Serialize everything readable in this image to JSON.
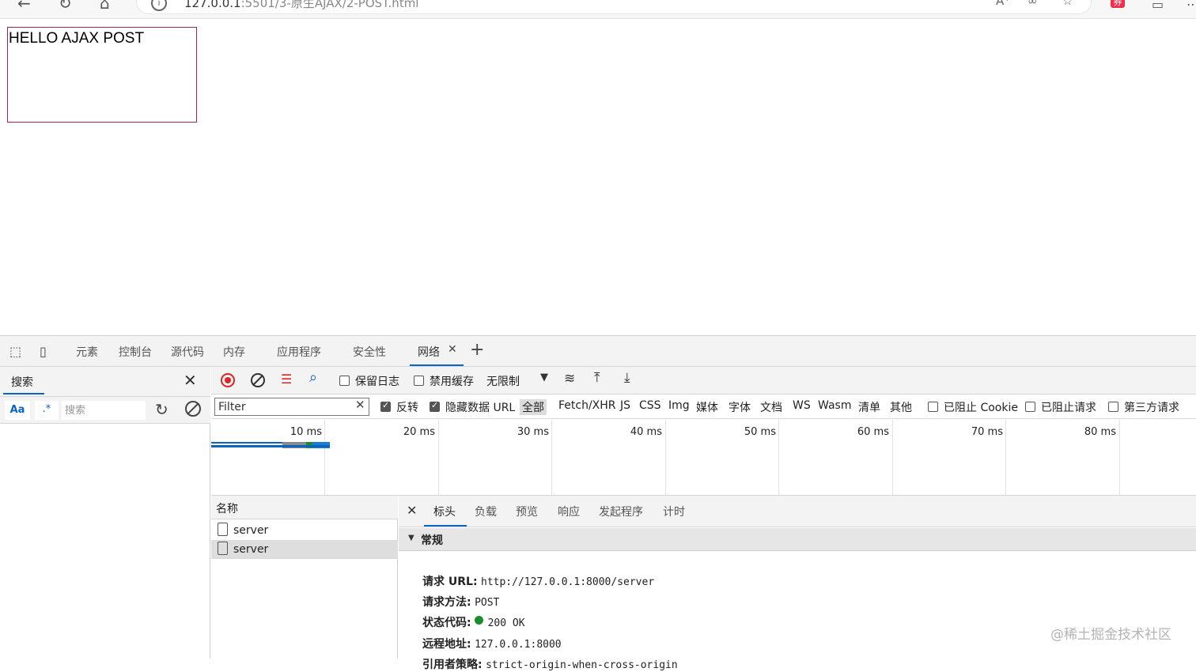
{
  "browser": {
    "url_host": "127.0.0.1",
    "url_rest": ":5501/3-原生AJAX/2-POST.html",
    "back_icon": "arrow-left-icon",
    "reload_icon": "reload-icon",
    "home_icon": "home-icon",
    "shop_badge": "券"
  },
  "page": {
    "box_text": "HELLO AJAX POST",
    "box_border_color": "#a0225a"
  },
  "devtools": {
    "tabs": [
      "元素",
      "控制台",
      "源代码",
      "内存",
      "应用程序",
      "安全性",
      "网络"
    ],
    "active_tab": "网络",
    "search_panel": {
      "tab_label": "搜索",
      "case_label": "Aa",
      "regex_label": ".*",
      "placeholder": "搜索"
    },
    "toolbar": {
      "preserve_log": "保留日志",
      "disable_cache": "禁用缓存",
      "throttle": "无限制"
    },
    "filter": {
      "placeholder": "Filter",
      "invert": "反转",
      "hide_data_urls": "隐藏数据 URL",
      "types": [
        "全部",
        "Fetch/XHR",
        "JS",
        "CSS",
        "Img",
        "媒体",
        "字体",
        "文档",
        "WS",
        "Wasm",
        "清单",
        "其他"
      ],
      "blocked_cookies": "已阻止 Cookie",
      "blocked_requests": "已阻止请求",
      "third_party": "第三方请求"
    },
    "timeline": {
      "ticks": [
        "10 ms",
        "20 ms",
        "30 ms",
        "40 ms",
        "50 ms",
        "60 ms",
        "70 ms",
        "80 ms"
      ]
    },
    "requests": {
      "header": "名称",
      "rows": [
        {
          "name": "server",
          "selected": false
        },
        {
          "name": "server",
          "selected": true
        }
      ]
    },
    "details": {
      "tabs": [
        "标头",
        "负载",
        "预览",
        "响应",
        "发起程序",
        "计时"
      ],
      "active_tab": "标头",
      "section_title": "常规",
      "fields": [
        {
          "key": "请求 URL:",
          "value": "http://127.0.0.1:8000/server"
        },
        {
          "key": "请求方法:",
          "value": "POST"
        },
        {
          "key": "状态代码:",
          "value": "200 OK"
        },
        {
          "key": "远程地址:",
          "value": "127.0.0.1:8000"
        },
        {
          "key": "引用者策略:",
          "value": "strict-origin-when-cross-origin"
        }
      ]
    }
  },
  "watermark": "@稀土掘金技术社区"
}
